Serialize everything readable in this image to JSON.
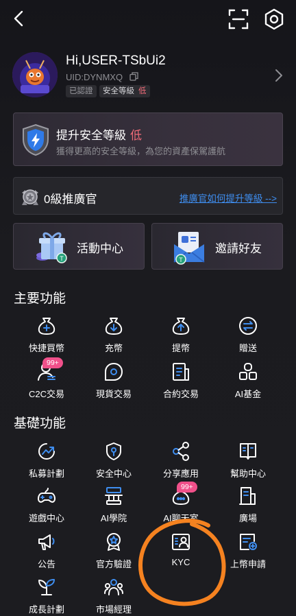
{
  "header": {
    "back_icon": "chevron-left-icon",
    "scan_icon": "scan-icon",
    "settings_icon": "settings-hexagon-icon"
  },
  "profile": {
    "greeting": "Hi,USER-TSbUi2",
    "uid": "UID:DYNMXQ",
    "verified_badge": "已認證",
    "security_label": "安全等級",
    "security_value": "低"
  },
  "security_card": {
    "title": "提升安全等級",
    "level": "低",
    "subtitle": "獲得更高的安全等級，為您的資產保駕護航"
  },
  "promoter": {
    "label": "0級推廣官",
    "link": "推廣官如何提升等級 -->"
  },
  "tiles": {
    "activity_center": "活動中心",
    "invite_friends": "邀請好友"
  },
  "main_functions": {
    "title": "主要功能",
    "items": [
      {
        "label": "快捷買幣",
        "icon": "moneybag-plus-icon"
      },
      {
        "label": "充幣",
        "icon": "moneybag-down-icon"
      },
      {
        "label": "提幣",
        "icon": "moneybag-up-icon"
      },
      {
        "label": "贈送",
        "icon": "transfer-icon"
      },
      {
        "label": "C2C交易",
        "icon": "c2c-user-icon",
        "badge": "99+"
      },
      {
        "label": "現貨交易",
        "icon": "spot-trade-icon"
      },
      {
        "label": "合約交易",
        "icon": "contract-doc-icon"
      },
      {
        "label": "AI基金",
        "icon": "ai-fund-icon"
      }
    ]
  },
  "basic_functions": {
    "title": "基礎功能",
    "items": [
      {
        "label": "私募計劃",
        "icon": "private-placement-icon"
      },
      {
        "label": "安全中心",
        "icon": "shield-key-icon"
      },
      {
        "label": "分享應用",
        "icon": "share-icon"
      },
      {
        "label": "幫助中心",
        "icon": "help-book-icon"
      },
      {
        "label": "遊戲中心",
        "icon": "gamepad-icon"
      },
      {
        "label": "AI學院",
        "icon": "academy-icon"
      },
      {
        "label": "AI聊天室",
        "icon": "chat-room-icon",
        "badge": "99+"
      },
      {
        "label": "廣場",
        "icon": "plaza-building-icon"
      },
      {
        "label": "公告",
        "icon": "megaphone-icon"
      },
      {
        "label": "官方驗證",
        "icon": "official-verify-icon"
      },
      {
        "label": "KYC",
        "icon": "kyc-id-icon"
      },
      {
        "label": "上幣申請",
        "icon": "listing-apply-icon"
      },
      {
        "label": "成長計劃",
        "icon": "sprout-icon"
      },
      {
        "label": "市場經理",
        "icon": "market-manager-icon"
      }
    ]
  },
  "colors": {
    "accent_link": "#3f8ef0",
    "warning_low": "#f06b78",
    "badge_pink": "#f0508a",
    "annotation": "#f58220"
  }
}
